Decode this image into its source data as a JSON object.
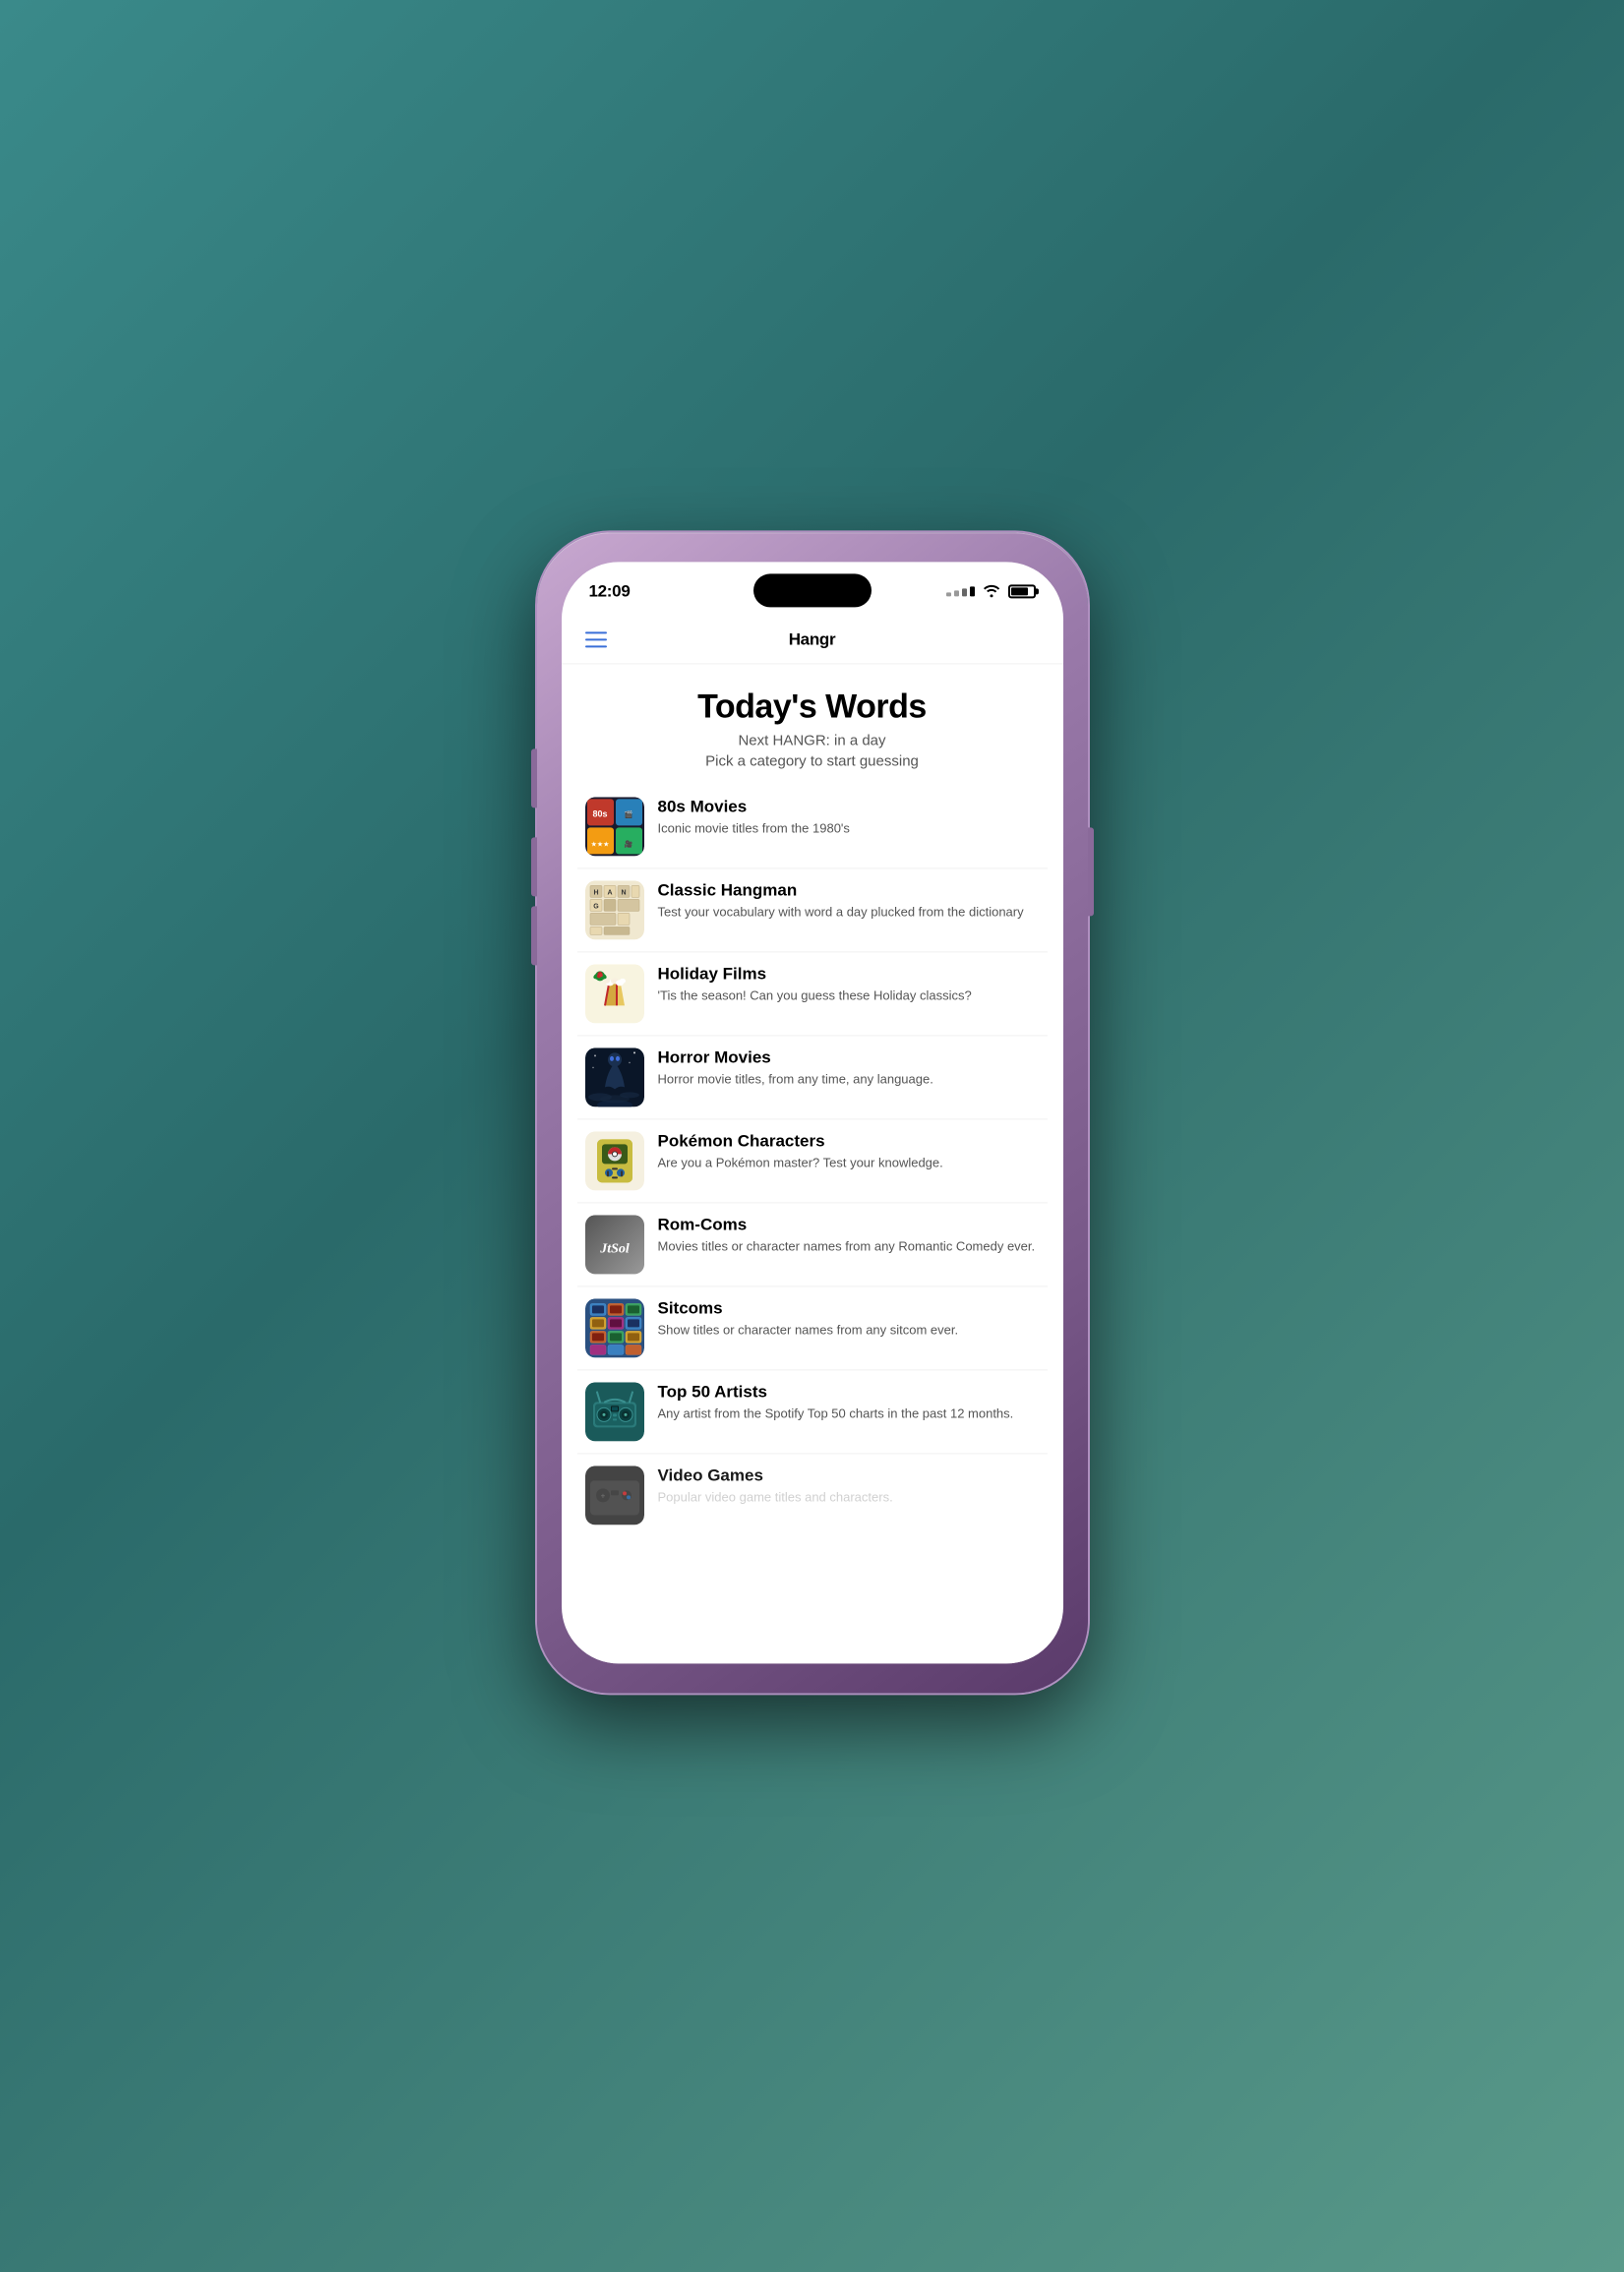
{
  "statusBar": {
    "time": "12:09",
    "batteryPct": 80
  },
  "nav": {
    "title": "Hangr",
    "menuLabel": "Menu"
  },
  "page": {
    "title": "Today's Words",
    "nextHangr": "Next HANGR: in a day",
    "subtitle": "Pick a category to start guessing"
  },
  "categories": [
    {
      "id": "80s-movies",
      "name": "80s Movies",
      "description": "Iconic movie titles from the 1980's",
      "thumbType": "80s",
      "emoji": "🎬"
    },
    {
      "id": "classic-hangman",
      "name": "Classic Hangman",
      "description": "Test your vocabulary with word a day plucked from the dictionary",
      "thumbType": "classic",
      "emoji": "📖"
    },
    {
      "id": "holiday-films",
      "name": "Holiday Films",
      "description": "'Tis the season! Can you guess these Holiday classics?",
      "thumbType": "holiday",
      "emoji": "🎄"
    },
    {
      "id": "horror-movies",
      "name": "Horror Movies",
      "description": "Horror movie titles, from any time, any language.",
      "thumbType": "horror",
      "emoji": "👻"
    },
    {
      "id": "pokemon",
      "name": "Pokémon Characters",
      "description": "Are you a Pokémon master? Test your knowledge.",
      "thumbType": "pokemon",
      "emoji": "🎮"
    },
    {
      "id": "rom-coms",
      "name": "Rom-Coms",
      "description": "Movies titles or character names from any Romantic Comedy ever.",
      "thumbType": "romcoms",
      "emoji": "❤️"
    },
    {
      "id": "sitcoms",
      "name": "Sitcoms",
      "description": "Show titles or character names from any sitcom ever.",
      "thumbType": "sitcoms",
      "emoji": "📺"
    },
    {
      "id": "top50-artists",
      "name": "Top 50 Artists",
      "description": "Any artist from the Spotify Top 50 charts in the past 12 months.",
      "thumbType": "top50",
      "emoji": "🎵"
    },
    {
      "id": "video-games",
      "name": "Video Games",
      "description": "Popular video game titles and characters.",
      "thumbType": "videogames",
      "emoji": "🕹️"
    }
  ]
}
